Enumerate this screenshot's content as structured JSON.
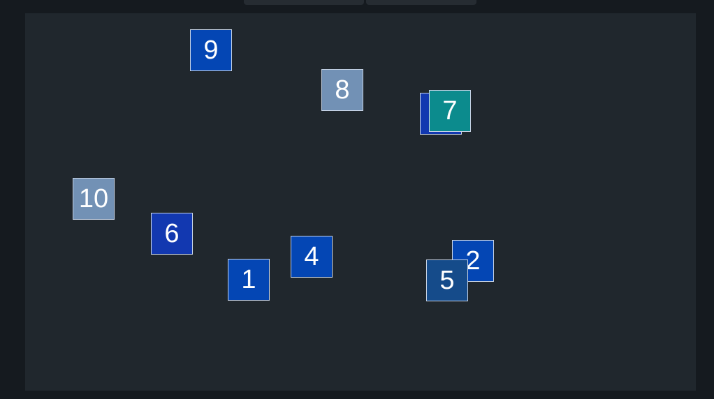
{
  "tabs": [
    "",
    ""
  ],
  "tiles": [
    {
      "label": "9",
      "color": "#0446b4"
    },
    {
      "label": "8",
      "color": "#7291b5"
    },
    {
      "label": "",
      "color": "#1238b0"
    },
    {
      "label": "7",
      "color": "#0c8b8d"
    },
    {
      "label": "10",
      "color": "#7291b5"
    },
    {
      "label": "6",
      "color": "#1238b0"
    },
    {
      "label": "4",
      "color": "#0446b4"
    },
    {
      "label": "1",
      "color": "#0446b4"
    },
    {
      "label": "2",
      "color": "#0446b4"
    },
    {
      "label": "5",
      "color": "#154b8a"
    }
  ]
}
